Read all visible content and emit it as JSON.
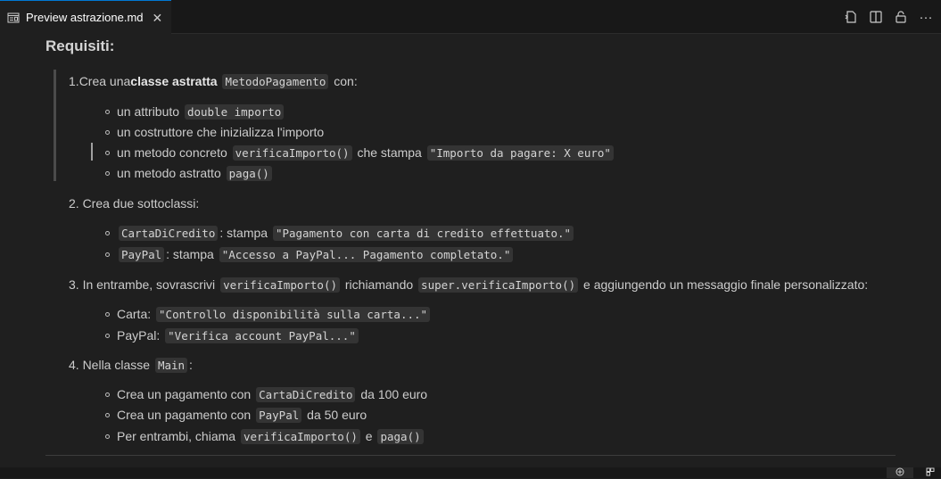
{
  "tab": {
    "title": "Preview astrazione.md",
    "close": "✕"
  },
  "toolbar": {
    "more": "···"
  },
  "doc": {
    "heading": "Requisiti:",
    "item1": {
      "num": "1. ",
      "pre": "Crea una ",
      "bold": "classe astratta",
      "code": "MetodoPagamento",
      "post": "con:",
      "bullets": {
        "b1_pre": "un attributo",
        "b1_code": "double importo",
        "b2": "un costruttore che inizializza l'importo",
        "b3_pre": "un metodo concreto",
        "b3_code": "verificaImporto()",
        "b3_mid": "che stampa",
        "b3_code2": "\"Importo da pagare: X euro\"",
        "b4_pre": "un metodo astratto",
        "b4_code": "paga()"
      }
    },
    "item2": {
      "text": "2. Crea due sottoclassi:",
      "b1_code": "CartaDiCredito",
      "b1_mid": ": stampa",
      "b1_code2": "\"Pagamento con carta di credito effettuato.\"",
      "b2_code": "PayPal",
      "b2_mid": ": stampa",
      "b2_code2": "\"Accesso a PayPal... Pagamento completato.\""
    },
    "item3": {
      "pre": "3. In entrambe, sovrascrivi",
      "code": "verificaImporto()",
      "mid": "richiamando",
      "code2": "super.verificaImporto()",
      "post": "e aggiungendo un messaggio finale personalizzato:",
      "b1_pre": "Carta:",
      "b1_code": "\"Controllo disponibilità sulla carta...\"",
      "b2_pre": "PayPal:",
      "b2_code": "\"Verifica account PayPal...\""
    },
    "item4": {
      "pre": "4. Nella classe",
      "code": "Main",
      "post": ":",
      "b1_pre": "Crea un pagamento con",
      "b1_code": "CartaDiCredito",
      "b1_post": "da 100 euro",
      "b2_pre": "Crea un pagamento con",
      "b2_code": "PayPal",
      "b2_post": "da 50 euro",
      "b3_pre": "Per entrambi, chiama",
      "b3_code": "verificaImporto()",
      "b3_mid": "e",
      "b3_code2": "paga()"
    }
  }
}
